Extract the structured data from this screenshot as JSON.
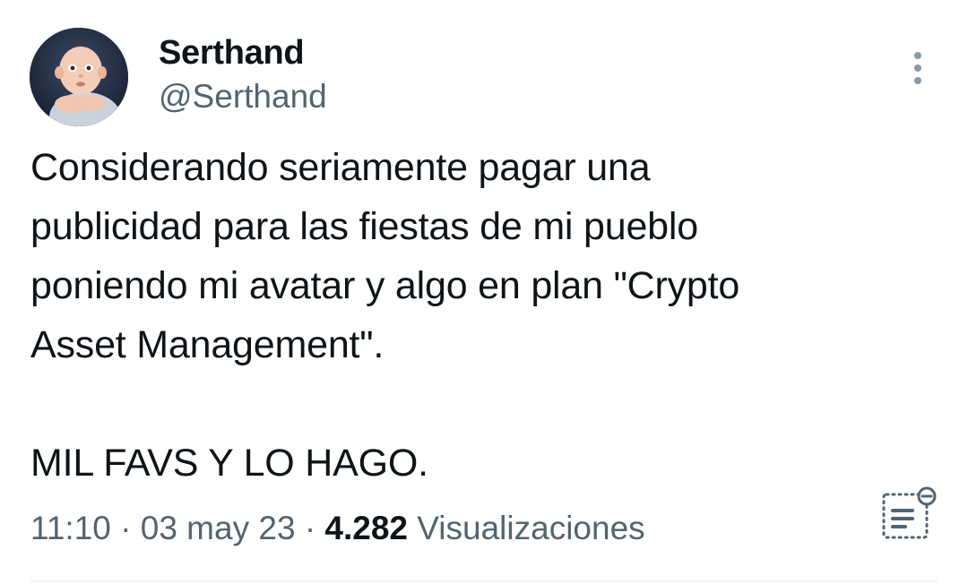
{
  "author": {
    "display_name": "Serthand",
    "handle": "@Serthand",
    "avatar_icon": "baby-photo-avatar"
  },
  "tweet": {
    "text": "Considerando seriamente pagar una\npublicidad para las fiestas de mi pueblo\nponiendo mi avatar y algo en plan \"Crypto\nAsset Management\".\n\nMIL FAVS Y LO HAGO."
  },
  "meta": {
    "time": "11:10",
    "separator": "·",
    "date": "03 may 23",
    "views_count": "4.282",
    "views_label": "Visualizaciones"
  },
  "icons": {
    "more": "more-vertical-icon",
    "analytics": "analytics-icon"
  },
  "colors": {
    "text_primary": "#0f1419",
    "text_secondary": "#536471",
    "icon_gray": "#8b98a5",
    "divider": "#eff3f4"
  }
}
